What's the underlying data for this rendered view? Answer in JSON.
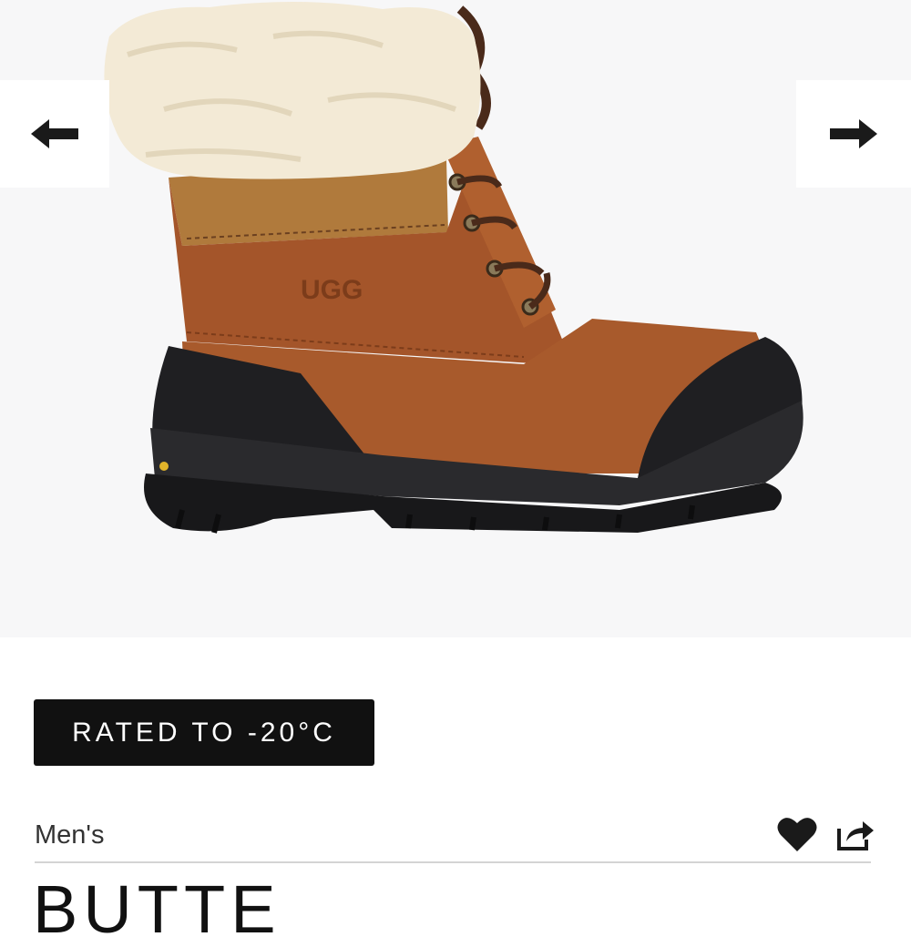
{
  "gallery": {
    "image_alt": "UGG Butte boot with sheepskin cuff",
    "logo_text": "UGG",
    "prev_icon": "arrow-left-icon",
    "next_icon": "arrow-right-icon"
  },
  "badge": {
    "label": "RATED TO -20°C"
  },
  "product": {
    "gender": "Men's",
    "title": "BUTTE"
  },
  "actions": {
    "favorite_icon": "heart-icon",
    "share_icon": "share-icon"
  },
  "colors": {
    "badge_bg": "#111111",
    "gallery_bg": "#f7f7f8",
    "leather": "#a4552a",
    "rubber": "#1c1c1e",
    "fur": "#f3ead6"
  }
}
